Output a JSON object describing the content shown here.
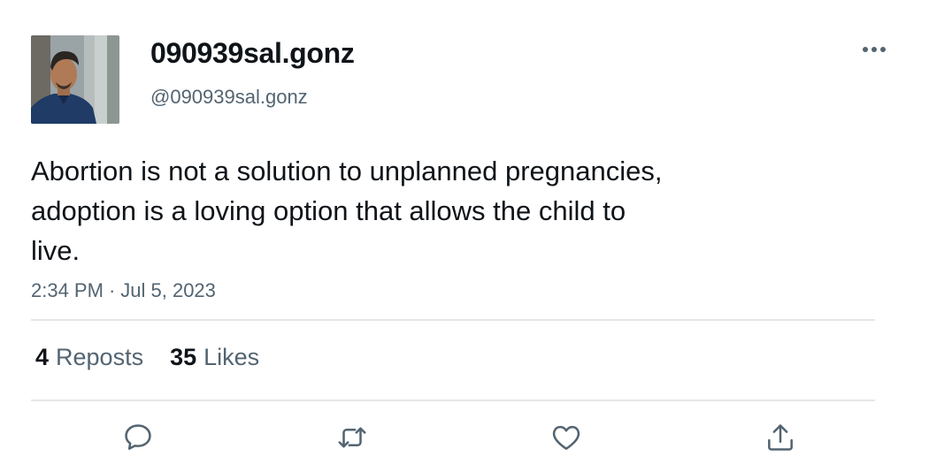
{
  "post": {
    "author": {
      "display_name": "090939sal.gonz",
      "handle": "@090939sal.gonz"
    },
    "text": "Abortion is not a solution to unplanned pregnancies,\nadoption is a loving option that allows the child to\nlive.",
    "time": "2:34 PM",
    "separator": "·",
    "date": "Jul 5, 2023",
    "stats": {
      "reposts_count": "4",
      "reposts_label": "Reposts",
      "likes_count": "35",
      "likes_label": "Likes"
    }
  },
  "icons": {
    "more": "more-horizontal-icon",
    "reply": "comment-icon",
    "repost": "repost-icon",
    "like": "heart-icon",
    "share": "share-icon"
  },
  "colors": {
    "text_primary": "#0f1419",
    "text_secondary": "#536471",
    "divider": "#e4e7ea"
  }
}
